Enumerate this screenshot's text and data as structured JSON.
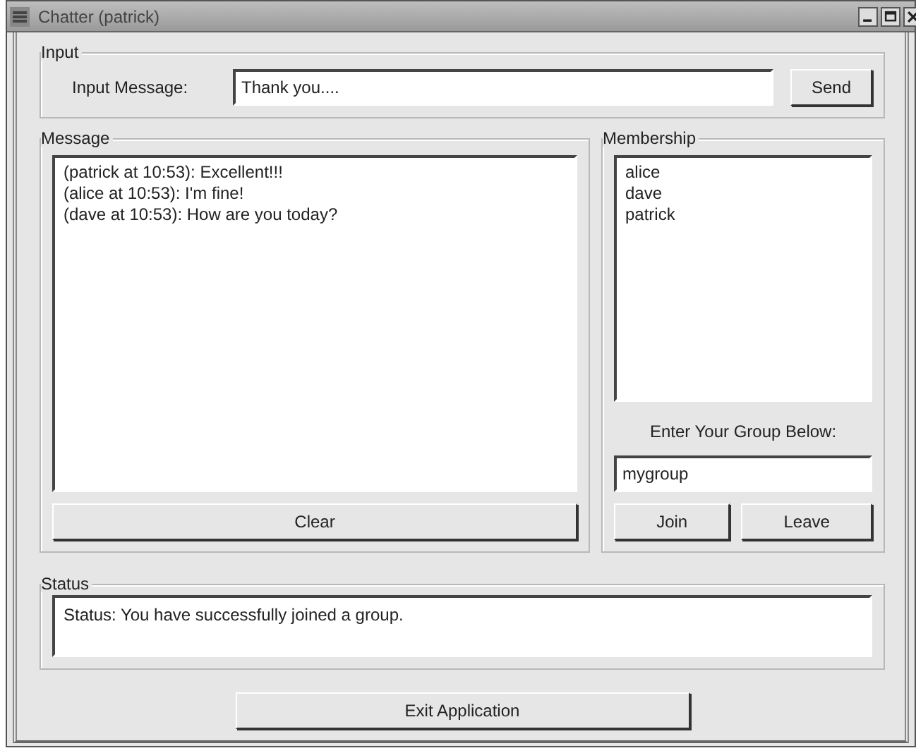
{
  "window": {
    "title": "Chatter (patrick)"
  },
  "input": {
    "legend": "Input",
    "label": "Input Message:",
    "value": "Thank you....",
    "button": "Send"
  },
  "message": {
    "legend": "Message",
    "lines": [
      "(patrick at 10:53): Excellent!!!",
      "(alice at 10:53): I'm fine!",
      "(dave at 10:53): How are you today?"
    ],
    "button": "Clear"
  },
  "membership": {
    "legend": "Membership",
    "members": [
      "alice",
      "dave",
      "patrick"
    ],
    "prompt": "Enter Your Group Below:",
    "group_value": "mygroup",
    "buttons": [
      "Join",
      "Leave"
    ]
  },
  "status": {
    "legend": "Status",
    "text": "Status: You have successfully joined a group."
  },
  "exit_button": "Exit Application"
}
